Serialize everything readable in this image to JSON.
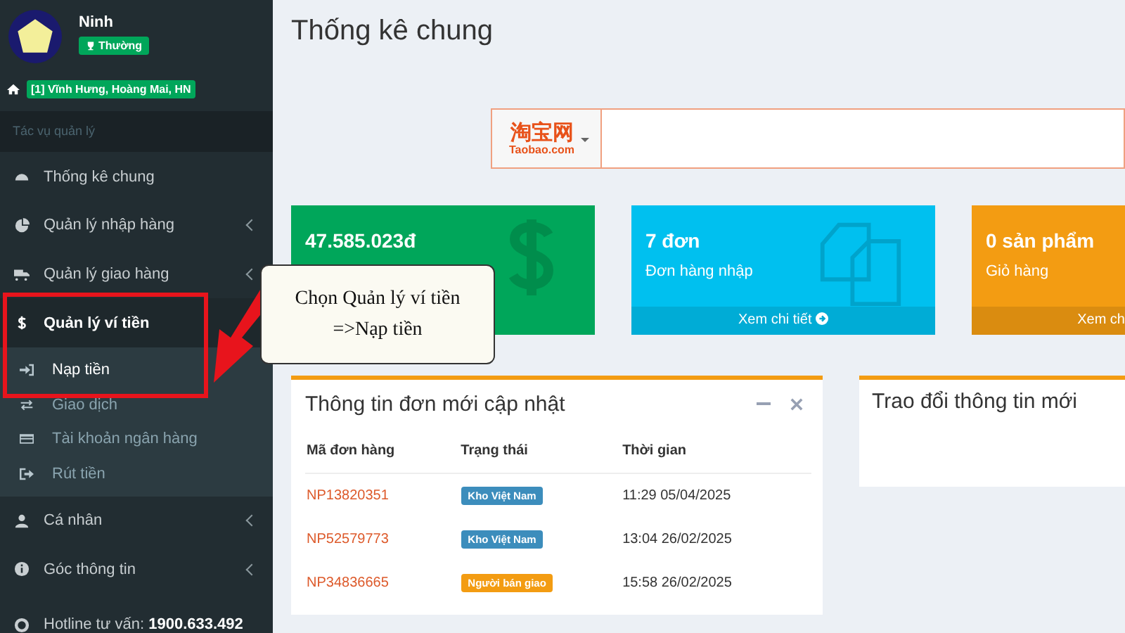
{
  "user": {
    "name": "Ninh",
    "rank": "Thường",
    "address": "[1] Vĩnh Hưng, Hoàng Mai, HN"
  },
  "sidebar": {
    "section": "Tác vụ quản lý",
    "items": [
      {
        "label": "Thống kê chung",
        "kind": "link",
        "selected": false
      },
      {
        "label": "Quản lý nhập hàng",
        "kind": "menu",
        "selected": false
      },
      {
        "label": "Quản lý giao hàng",
        "kind": "menu",
        "selected": false
      },
      {
        "label": "Quản lý ví tiền",
        "kind": "open",
        "selected": true,
        "children": [
          {
            "label": "Nạp tiền",
            "selected": true
          },
          {
            "label": "Giao dịch",
            "selected": false
          },
          {
            "label": "Tài khoản ngân hàng",
            "selected": false
          },
          {
            "label": "Rút tiền",
            "selected": false
          }
        ]
      },
      {
        "label": "Cá nhân",
        "kind": "menu",
        "selected": false
      },
      {
        "label": "Góc thông tin",
        "kind": "menu",
        "selected": false
      }
    ],
    "hotline_label": "Hotline tư vấn:",
    "hotline": "1900.633.492"
  },
  "page_title": "Thống kê chung",
  "search": {
    "site_cn": "淘宝网",
    "site": "Taobao.com"
  },
  "cards": [
    {
      "value": "47.585.023đ",
      "color": "#00a65a"
    },
    {
      "value": "7 đơn",
      "label": "Đơn hàng nhập",
      "link": "Xem chi tiết",
      "color": "#00c0ef"
    },
    {
      "value": "0 sản phẩm",
      "label": "Giỏ hàng",
      "link": "Xem ch",
      "color": "#f39c12"
    }
  ],
  "orders_panel": {
    "title": "Thông tin đơn mới cập nhật",
    "columns": [
      "Mã đơn hàng",
      "Trạng thái",
      "Thời gian"
    ],
    "rows": [
      {
        "code": "NP13820351",
        "status": "Kho Việt Nam",
        "color": "#3c8dbc",
        "time": "11:29 05/04/2025"
      },
      {
        "code": "NP52579773",
        "status": "Kho Việt Nam",
        "color": "#3c8dbc",
        "time": "13:04 26/02/2025"
      },
      {
        "code": "NP34836665",
        "status": "Người bán giao",
        "color": "#f39c12",
        "time": "15:58 26/02/2025"
      }
    ]
  },
  "chat_panel": {
    "title": "Trao đổi thông tin mới"
  },
  "callout": {
    "lines": [
      "Chọn Quản lý ví tiền",
      "=>Nạp tiền"
    ]
  }
}
